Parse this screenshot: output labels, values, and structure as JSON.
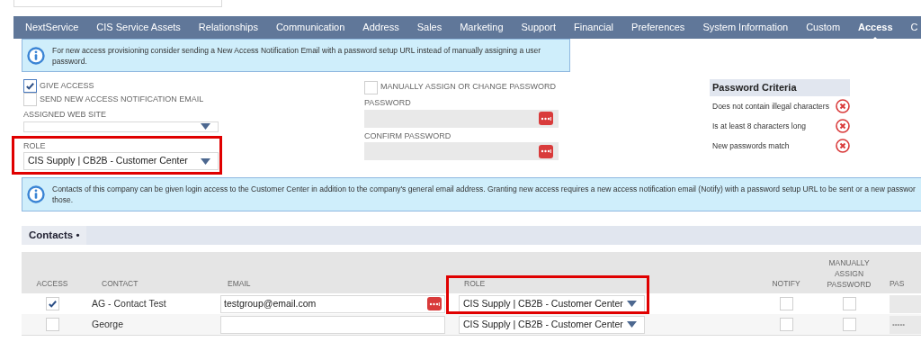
{
  "tabs": [
    {
      "label": "NextService",
      "selected": false
    },
    {
      "label": "CIS Service Assets",
      "selected": false
    },
    {
      "label": "Relationships",
      "selected": false
    },
    {
      "label": "Communication",
      "selected": false
    },
    {
      "label": "Address",
      "selected": false
    },
    {
      "label": "Sales",
      "selected": false
    },
    {
      "label": "Marketing",
      "selected": false
    },
    {
      "label": "Support",
      "selected": false
    },
    {
      "label": "Financial",
      "selected": false
    },
    {
      "label": "Preferences",
      "selected": false
    },
    {
      "label": "System Information",
      "selected": false
    },
    {
      "label": "Custom",
      "selected": false
    },
    {
      "label": "Access",
      "selected": true
    },
    {
      "label": "C",
      "selected": false
    }
  ],
  "notice": "For new access provisioning consider sending a New Access Notification Email with a password setup URL instead of manually assigning a user password.",
  "give_access": {
    "label": "GIVE ACCESS",
    "checked": true
  },
  "send_notification": {
    "label": "SEND NEW ACCESS NOTIFICATION EMAIL",
    "checked": false
  },
  "assigned_web_site": {
    "label": "ASSIGNED WEB SITE"
  },
  "role": {
    "label": "ROLE",
    "value": "CIS Supply | CB2B - Customer Center"
  },
  "manually_assign": {
    "label": "MANUALLY ASSIGN OR CHANGE PASSWORD",
    "checked": false
  },
  "password": {
    "label": "PASSWORD"
  },
  "confirm_password": {
    "label": "CONFIRM PASSWORD"
  },
  "criteria": {
    "title": "Password Criteria",
    "items": [
      {
        "text": "Does not contain illegal characters",
        "met": false
      },
      {
        "text": "Is at least 8 characters long",
        "met": false
      },
      {
        "text": "New passwords match",
        "met": false
      }
    ]
  },
  "contacts_notice": "Contacts of this company can be given login access to the Customer Center in addition to the company's general email address. Granting new access requires a new access notification email (Notify) with a password setup URL to be sent or a new passwor those.",
  "contacts": {
    "title": "Contacts •",
    "columns": [
      "ACCESS",
      "CONTACT",
      "EMAIL",
      "ROLE",
      "NOTIFY",
      "MANUALLY ASSIGN PASSWORD",
      "PAS"
    ],
    "rows": [
      {
        "access": true,
        "contact": "AG - Contact Test",
        "email": "testgroup@email.com",
        "role": "CIS Supply | CB2B - Customer Center",
        "notify": false,
        "manually_assign": false
      },
      {
        "access": false,
        "contact": "George",
        "role": "CIS Supply | CB2B - Customer Center",
        "notify": false,
        "manually_assign": false,
        "password": "•••••"
      }
    ]
  }
}
